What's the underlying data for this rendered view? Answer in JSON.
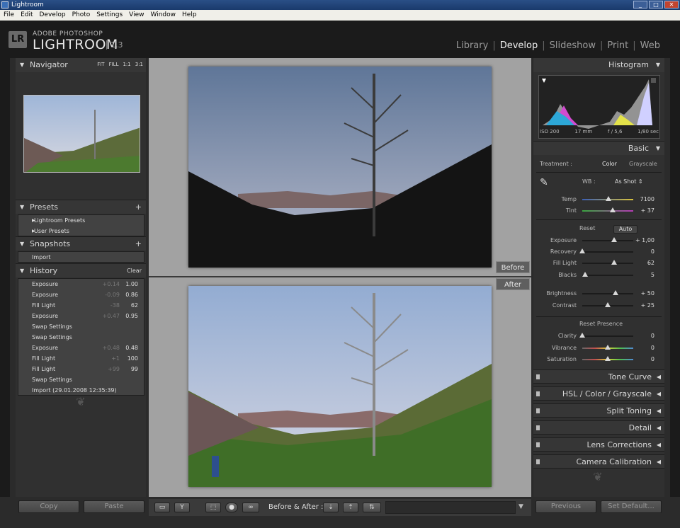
{
  "window": {
    "title": "Lightroom"
  },
  "menu": [
    "File",
    "Edit",
    "Develop",
    "Photo",
    "Settings",
    "View",
    "Window",
    "Help"
  ],
  "brand": {
    "badge": "LR",
    "top": "ADOBE PHOTOSHOP",
    "main": "LIGHTROOM",
    "version": "1.3"
  },
  "modules": [
    {
      "label": "Library",
      "active": false
    },
    {
      "label": "Develop",
      "active": true
    },
    {
      "label": "Slideshow",
      "active": false
    },
    {
      "label": "Print",
      "active": false
    },
    {
      "label": "Web",
      "active": false
    }
  ],
  "navigator": {
    "title": "Navigator",
    "zoom": [
      "FIT",
      "FILL",
      "1:1",
      "3:1"
    ]
  },
  "presets": {
    "title": "Presets",
    "items": [
      "Lightroom Presets",
      "User Presets"
    ]
  },
  "snapshots": {
    "title": "Snapshots",
    "items": [
      "Import"
    ]
  },
  "history": {
    "title": "History",
    "clear": "Clear",
    "items": [
      {
        "name": "Exposure",
        "delta": "+0.14",
        "value": "1.00"
      },
      {
        "name": "Exposure",
        "delta": "-0.09",
        "value": "0.86"
      },
      {
        "name": "Fill Light",
        "delta": "-38",
        "value": "62"
      },
      {
        "name": "Exposure",
        "delta": "+0.47",
        "value": "0.95"
      },
      {
        "name": "Swap Settings",
        "delta": "",
        "value": ""
      },
      {
        "name": "Swap Settings",
        "delta": "",
        "value": ""
      },
      {
        "name": "Exposure",
        "delta": "+0.48",
        "value": "0.48"
      },
      {
        "name": "Fill Light",
        "delta": "+1",
        "value": "100"
      },
      {
        "name": "Fill Light",
        "delta": "+99",
        "value": "99"
      },
      {
        "name": "Swap Settings",
        "delta": "",
        "value": ""
      },
      {
        "name": "Import (29.01.2008 12:35:39)",
        "delta": "",
        "value": ""
      }
    ]
  },
  "left_buttons": {
    "copy": "Copy",
    "paste": "Paste"
  },
  "center": {
    "before_label": "Before",
    "after_label": "After"
  },
  "toolbar": {
    "before_after_label": "Before & After :"
  },
  "histogram": {
    "title": "Histogram",
    "meta": [
      "ISO 200",
      "17 mm",
      "f / 5,6",
      "1/80 sec"
    ]
  },
  "basic": {
    "title": "Basic",
    "treatment_label": "Treatment :",
    "treatment_options": [
      "Color",
      "Grayscale"
    ],
    "wb_label": "WB :",
    "wb_value": "As Shot",
    "reset_label": "Reset",
    "auto_label": "Auto",
    "reset_presence_label": "Reset Presence",
    "sliders": [
      {
        "label": "Temp",
        "value": "7100",
        "pos": 0.52
      },
      {
        "label": "Tint",
        "value": "+ 37",
        "pos": 0.6
      },
      {
        "label": "Exposure",
        "value": "+ 1,00",
        "pos": 0.62
      },
      {
        "label": "Recovery",
        "value": "0",
        "pos": 0.0
      },
      {
        "label": "Fill Light",
        "value": "62",
        "pos": 0.62
      },
      {
        "label": "Blacks",
        "value": "5",
        "pos": 0.05
      },
      {
        "label": "Brightness",
        "value": "+ 50",
        "pos": 0.65
      },
      {
        "label": "Contrast",
        "value": "+ 25",
        "pos": 0.5
      },
      {
        "label": "Clarity",
        "value": "0",
        "pos": 0.0
      },
      {
        "label": "Vibrance",
        "value": "0",
        "pos": 0.5
      },
      {
        "label": "Saturation",
        "value": "0",
        "pos": 0.5
      }
    ]
  },
  "right_sections": [
    "Tone Curve",
    "HSL / Color / Grayscale",
    "Split Toning",
    "Detail",
    "Lens Corrections",
    "Camera Calibration"
  ],
  "right_buttons": {
    "previous": "Previous",
    "set_default": "Set Default..."
  }
}
